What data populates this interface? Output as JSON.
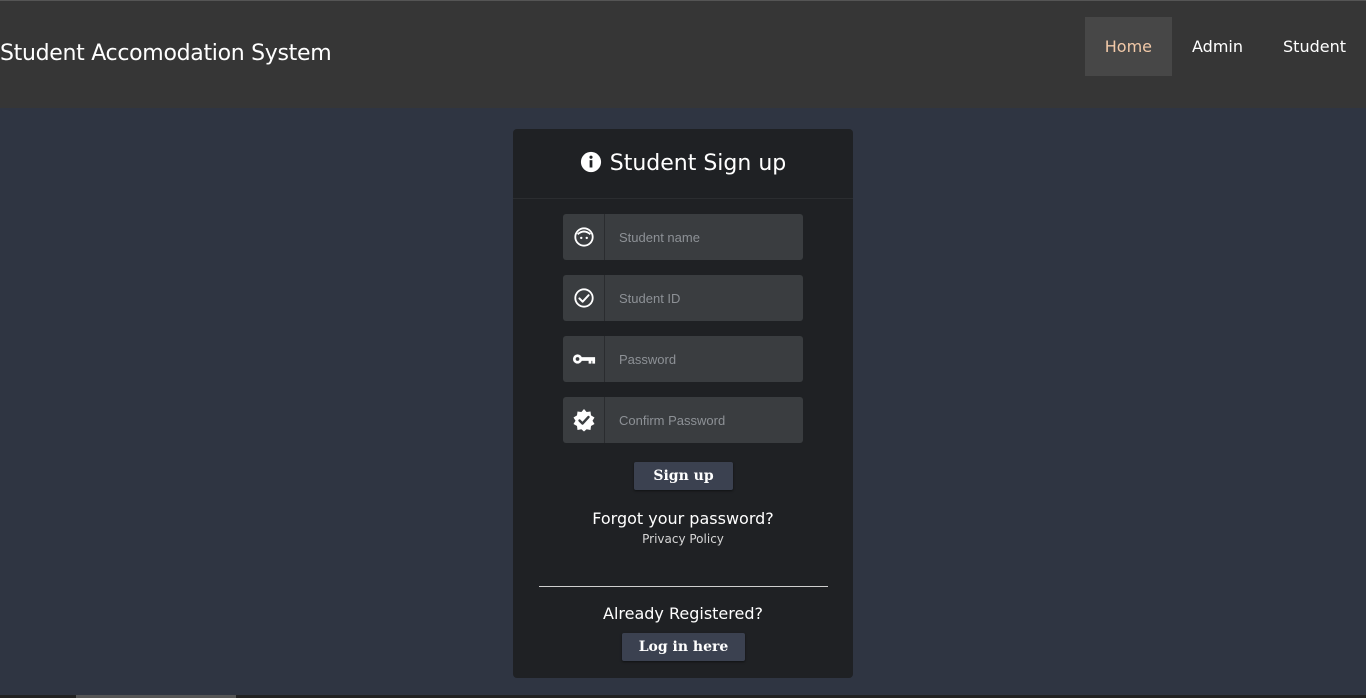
{
  "navbar": {
    "brand": "Student Accomodation System",
    "links": [
      {
        "label": "Home",
        "active": true
      },
      {
        "label": "Admin",
        "active": false
      },
      {
        "label": "Student",
        "active": false
      }
    ]
  },
  "signup": {
    "title": "Student Sign up",
    "fields": {
      "name_placeholder": "Student name",
      "id_placeholder": "Student ID",
      "password_placeholder": "Password",
      "confirm_placeholder": "Confirm Password"
    },
    "submit_label": "Sign up",
    "forgot_text": "Forgot your password?",
    "privacy_text": "Privacy Policy",
    "already_text": "Already Registered?",
    "login_label": "Log in here"
  },
  "colors": {
    "page_bg": "#2f3542",
    "navbar_bg": "#363636",
    "active_link_bg": "#474747",
    "active_link_text": "#f2c9a8",
    "card_bg": "#1f2124",
    "input_bg": "#3a3d40",
    "button_bg": "#3b4150"
  },
  "icons": {
    "title": "info-circle-icon",
    "name": "face-icon",
    "id": "check-circle-icon",
    "password": "key-icon",
    "confirm": "verified-badge-icon"
  }
}
